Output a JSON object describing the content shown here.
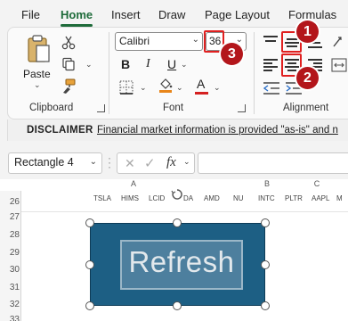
{
  "tabs": [
    "File",
    "Home",
    "Insert",
    "Draw",
    "Page Layout",
    "Formulas"
  ],
  "active_tab": "Home",
  "ribbon": {
    "clipboard": {
      "paste_label": "Paste",
      "group_label": "Clipboard"
    },
    "font": {
      "font_name": "Calibri",
      "font_size": "36",
      "bold": "B",
      "italic": "I",
      "underline": "U",
      "font_color_letter": "A",
      "group_label": "Font"
    },
    "alignment": {
      "group_label": "Alignment"
    }
  },
  "markers": [
    "1",
    "2",
    "3"
  ],
  "disclaimer": {
    "title": "DISCLAIMER",
    "text": "Financial market information is provided \"as-is\" and n"
  },
  "formula_bar": {
    "name_box": "Rectangle 4",
    "cancel": "✕",
    "enter": "✓",
    "fx": "fx",
    "formula": ""
  },
  "grid": {
    "columns": [
      "A",
      "B",
      "C"
    ],
    "rows": [
      "26",
      "27",
      "28",
      "29",
      "30",
      "31",
      "32",
      "33"
    ],
    "tickers": [
      "TSLA",
      "HIMS",
      "LCID",
      "DA",
      "AMD",
      "NU",
      "INTC",
      "PLTR",
      "AAPL",
      "M"
    ]
  },
  "shape_text": "Refresh",
  "colors": {
    "accent_green": "#1e6b3a",
    "marker_red": "#b3161b",
    "shape_fill": "#1d5f84",
    "highlight_red": "#e02020"
  }
}
